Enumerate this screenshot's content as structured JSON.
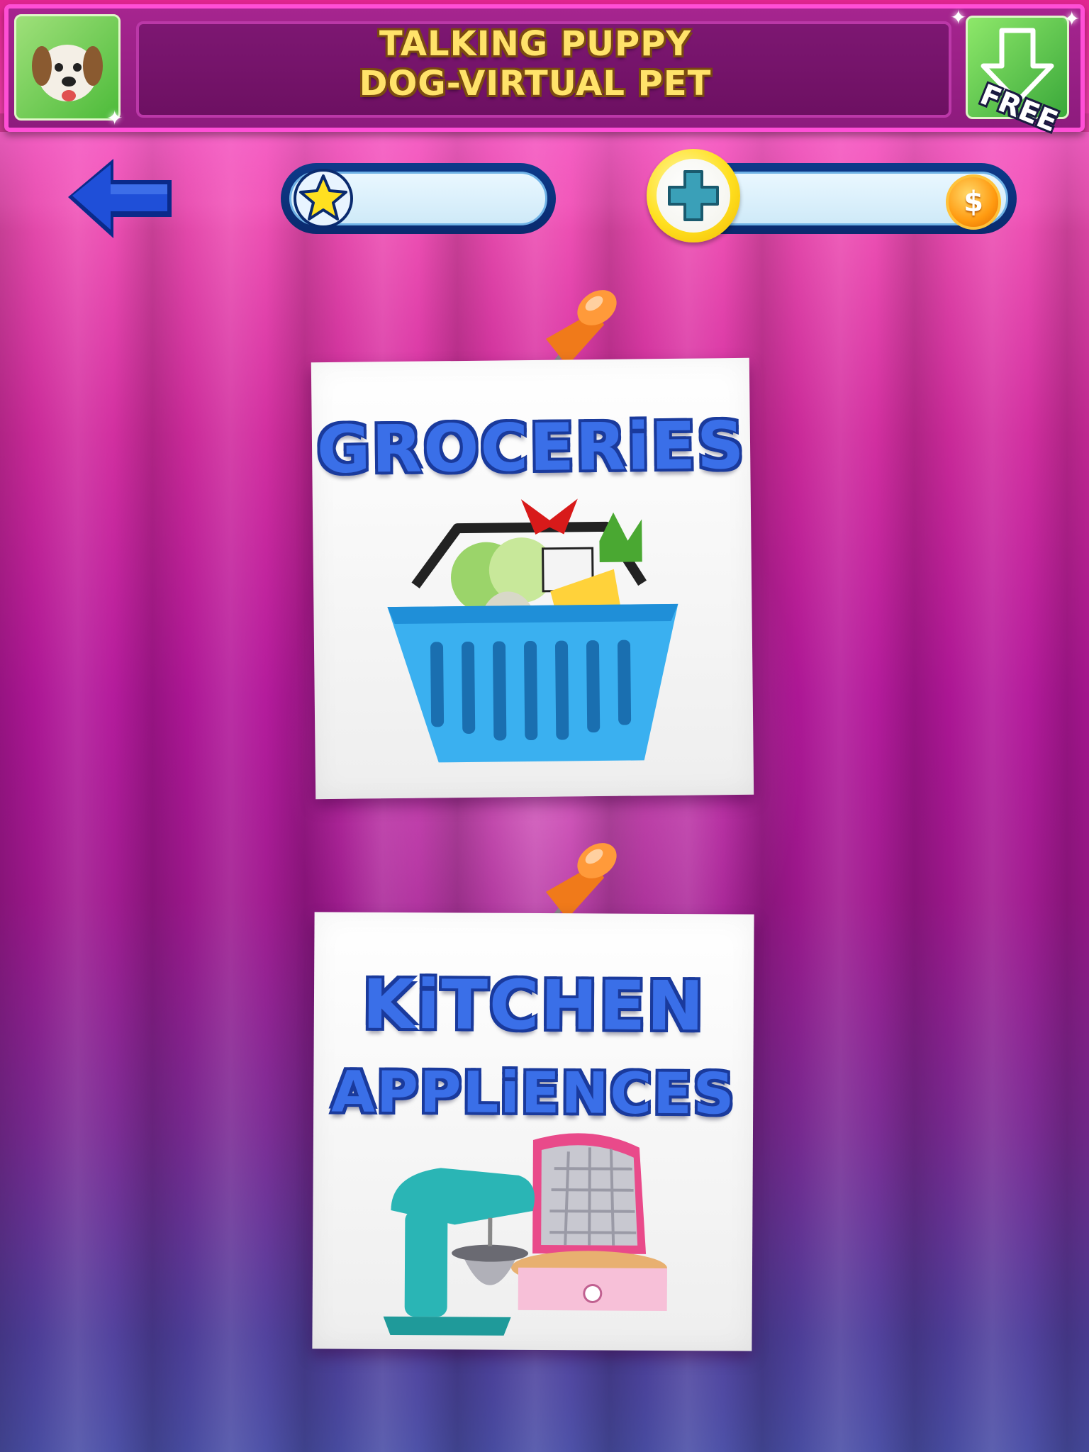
{
  "ad_banner": {
    "title_line1": "TALKING PUPPY",
    "title_line2": "DOG-VIRTUAL PET",
    "badge": "FREE",
    "app_icon": "puppy-icon",
    "download_icon": "download-arrow-icon"
  },
  "hud": {
    "back_icon": "back-arrow-icon",
    "stars_icon": "star-icon",
    "add_icon": "plus-icon",
    "coin_icon": "coin-icon",
    "coin_symbol": "$"
  },
  "cards": [
    {
      "title": "GROCERiES",
      "illustration": "grocery-basket-icon"
    },
    {
      "title_line1": "KiTCHEN",
      "title_line2": "APPLiENCES",
      "illustration": "kitchen-mixer-waffle-icon"
    }
  ],
  "colors": {
    "banner": "#8d1b7d",
    "banner_border": "#ff4fd6",
    "title_blue": "#3a6fe8",
    "bar_blue": "#0a2a6e",
    "coin": "#ff9a10"
  }
}
